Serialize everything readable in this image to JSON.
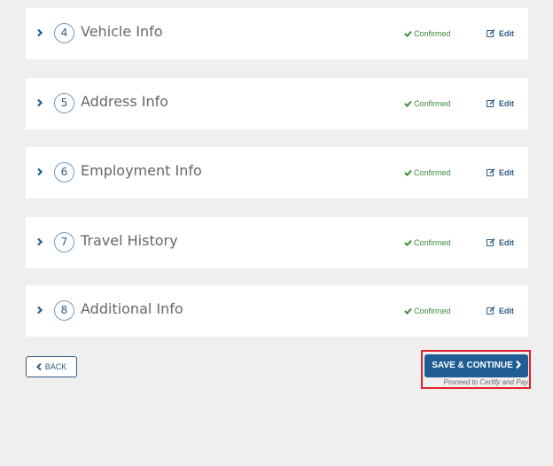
{
  "sections": [
    {
      "number": "4",
      "title": "Vehicle Info",
      "status": "Confirmed",
      "edit_label": "Edit"
    },
    {
      "number": "5",
      "title": "Address Info",
      "status": "Confirmed",
      "edit_label": "Edit"
    },
    {
      "number": "6",
      "title": "Employment Info",
      "status": "Confirmed",
      "edit_label": "Edit"
    },
    {
      "number": "7",
      "title": "Travel History",
      "status": "Confirmed",
      "edit_label": "Edit"
    },
    {
      "number": "8",
      "title": "Additional Info",
      "status": "Confirmed",
      "edit_label": "Edit"
    }
  ],
  "footer": {
    "back_label": "BACK",
    "save_label": "SAVE & CONTINUE",
    "save_sublabel": "Proceed to Certify and Pay"
  },
  "colors": {
    "primary": "#1f5d94",
    "confirmed": "#3a8a3a",
    "highlight": "#e0232e",
    "background": "#efefef"
  }
}
